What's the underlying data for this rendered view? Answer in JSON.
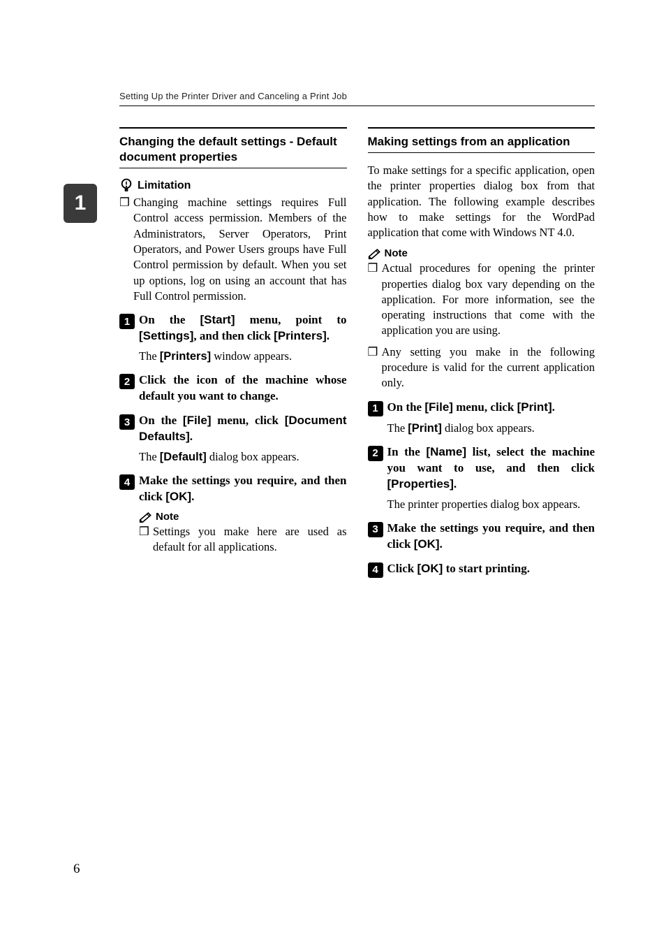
{
  "running_head": "Setting Up the Printer Driver and Canceling a Print Job",
  "side_tab": "1",
  "page_number": "6",
  "left": {
    "heading": "Changing the default settings - Default document properties",
    "limitation": {
      "label": "Limitation",
      "items": [
        "Changing machine settings requires Full Control access permission. Members of the Administrators, Server Operators, Print Operators, and Power Users groups have Full Control permission by default. When you set up options, log on using an account that has Full Control permission."
      ]
    },
    "steps": [
      {
        "num": "1",
        "head_pre": "On the ",
        "ui1": "[Start]",
        "head_mid1": " menu, point to ",
        "ui2": "[Settings]",
        "head_mid2": ", and then click ",
        "ui3": "[Printers]",
        "head_post": ".",
        "body_pre": "The ",
        "body_ui": "[Printers]",
        "body_post": " window appears."
      },
      {
        "num": "2",
        "head_full": "Click the icon of the machine whose default you want to change."
      },
      {
        "num": "3",
        "head_pre": "On the ",
        "ui1": "[File]",
        "head_mid1": " menu, click ",
        "ui2": "[Document Defaults]",
        "head_post": ".",
        "body_pre": "The ",
        "body_ui": "[Default]",
        "body_post": " dialog box appears."
      },
      {
        "num": "4",
        "head_pre": "Make the settings you require, and then click ",
        "ui1": "[OK]",
        "head_post": ".",
        "note_label": "Note",
        "note_items": [
          "Settings you make here are used as default for all applications."
        ]
      }
    ]
  },
  "right": {
    "heading": "Making settings from an application",
    "intro": "To make settings for a specific application, open the printer properties dialog box from that application. The following example describes how to make settings for the WordPad application that come with Windows NT 4.0.",
    "note": {
      "label": "Note",
      "items": [
        "Actual procedures for opening the printer properties dialog box vary depending on the application. For more information, see the operating instructions that come with the application you are using.",
        "Any setting you make in the following procedure is valid for the current application only."
      ]
    },
    "steps": [
      {
        "num": "1",
        "head_pre": "On the ",
        "ui1": "[File]",
        "head_mid1": " menu, click ",
        "ui2": "[Print]",
        "head_post": ".",
        "body_pre": "The ",
        "body_ui": "[Print]",
        "body_post": " dialog box appears."
      },
      {
        "num": "2",
        "head_pre": "In the ",
        "ui1": "[Name]",
        "head_mid1": " list, select the machine you want to use, and then click ",
        "ui2": "[Properties]",
        "head_post": ".",
        "body_full": "The printer properties dialog box appears."
      },
      {
        "num": "3",
        "head_pre": "Make the settings you require, and then click ",
        "ui1": "[OK]",
        "head_post": "."
      },
      {
        "num": "4",
        "head_pre": "Click ",
        "ui1": "[OK]",
        "head_mid1": " to start printing."
      }
    ]
  }
}
